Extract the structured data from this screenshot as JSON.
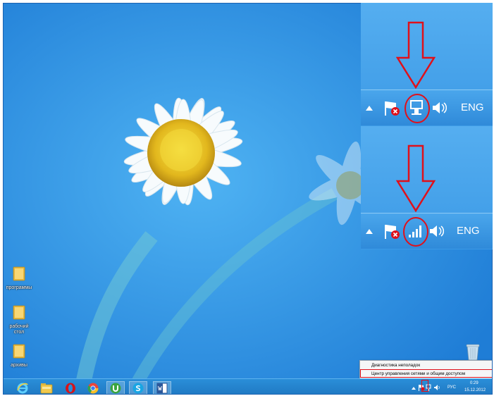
{
  "desktop": {
    "icons": [
      {
        "label": "программы"
      },
      {
        "label": "рабочий стол"
      },
      {
        "label": "архивы"
      }
    ]
  },
  "taskbar": {
    "apps": [
      {
        "icon": "internet-explorer-icon"
      },
      {
        "icon": "file-explorer-icon"
      },
      {
        "icon": "opera-icon"
      },
      {
        "icon": "chrome-icon"
      },
      {
        "icon": "utorrent-icon"
      },
      {
        "icon": "skype-icon"
      },
      {
        "icon": "word-icon"
      }
    ],
    "tray": {
      "language": "РУС",
      "time": "0:29",
      "date": "15.12.2012"
    }
  },
  "context_menu": {
    "items": [
      {
        "label": "Диагностика неполадок"
      },
      {
        "label": "Центр управления сетями и общим доступом"
      }
    ]
  },
  "zoom_panels": [
    {
      "network_icon": "wired-network-icon",
      "language": "ENG"
    },
    {
      "network_icon": "wireless-signal-icon",
      "language": "ENG"
    }
  ],
  "colors": {
    "highlight": "#e0101a",
    "taskbar": "#1f78c2",
    "desktop": "#2a8be0"
  }
}
